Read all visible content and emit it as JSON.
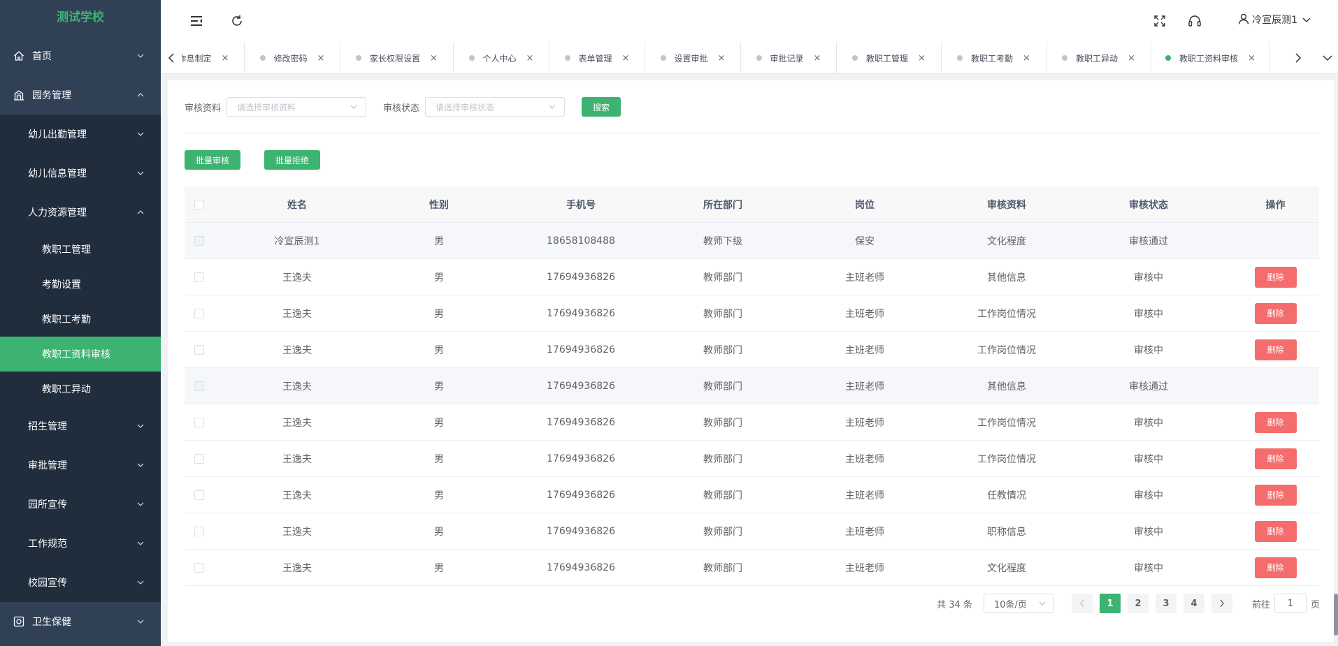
{
  "app": {
    "title": "测试学校",
    "accent": "#3cb371",
    "sidebar_bg": "#304156"
  },
  "sidebar": {
    "items": [
      {
        "label": "首页",
        "icon": "home-icon",
        "level": 1,
        "expanded": false
      },
      {
        "label": "园务管理",
        "icon": "building-icon",
        "level": 1,
        "expanded": true
      },
      {
        "label": "幼儿出勤管理",
        "level": 2,
        "expanded": false
      },
      {
        "label": "幼儿信息管理",
        "level": 2,
        "expanded": false
      },
      {
        "label": "人力资源管理",
        "level": 2,
        "expanded": true
      },
      {
        "label": "教职工管理",
        "level": 3
      },
      {
        "label": "考勤设置",
        "level": 3
      },
      {
        "label": "教职工考勤",
        "level": 3
      },
      {
        "label": "教职工资料审核",
        "level": 3,
        "active": true
      },
      {
        "label": "教职工异动",
        "level": 3
      },
      {
        "label": "招生管理",
        "level": 2,
        "expanded": false
      },
      {
        "label": "审批管理",
        "level": 2,
        "expanded": false
      },
      {
        "label": "园所宣传",
        "level": 2,
        "expanded": false
      },
      {
        "label": "工作规范",
        "level": 2,
        "expanded": false
      },
      {
        "label": "校园宣传",
        "level": 2,
        "expanded": false
      },
      {
        "label": "卫生保健",
        "icon": "health-icon",
        "level": 1,
        "expanded": false
      }
    ]
  },
  "header": {
    "user_name": "冷宣辰测1",
    "icons": [
      "menu-fold-icon",
      "refresh-icon",
      "fullscreen-icon",
      "headset-icon",
      "user-icon"
    ]
  },
  "tags": {
    "items": [
      {
        "label": "作息制定",
        "active": false,
        "dot": false
      },
      {
        "label": "修改密码",
        "active": false,
        "dot": true
      },
      {
        "label": "家长权限设置",
        "active": false,
        "dot": true
      },
      {
        "label": "个人中心",
        "active": false,
        "dot": true
      },
      {
        "label": "表单管理",
        "active": false,
        "dot": true
      },
      {
        "label": "设置审批",
        "active": false,
        "dot": true
      },
      {
        "label": "审批记录",
        "active": false,
        "dot": true
      },
      {
        "label": "教职工管理",
        "active": false,
        "dot": true
      },
      {
        "label": "教职工考勤",
        "active": false,
        "dot": true
      },
      {
        "label": "教职工异动",
        "active": false,
        "dot": true
      },
      {
        "label": "教职工资料审核",
        "active": true,
        "dot": true
      }
    ],
    "close_glyph": "×"
  },
  "filter": {
    "data_label": "审核资料",
    "data_placeholder": "请选择审核资料",
    "status_label": "审核状态",
    "status_placeholder": "请选择审核状态",
    "search_label": "搜索"
  },
  "actions": {
    "batch_approve": "批量审核",
    "batch_reject": "批量拒绝"
  },
  "table": {
    "columns": [
      "姓名",
      "性别",
      "手机号",
      "所在部门",
      "岗位",
      "审核资料",
      "审核状态",
      "操作"
    ],
    "delete_label": "删除",
    "rows": [
      {
        "name": "冷宣辰测1",
        "gender": "男",
        "phone": "18658108488",
        "dept": "教师下级",
        "post": "保安",
        "data": "文化程度",
        "status": "审核通过",
        "deletable": false
      },
      {
        "name": "王逸夫",
        "gender": "男",
        "phone": "17694936826",
        "dept": "教师部门",
        "post": "主班老师",
        "data": "其他信息",
        "status": "审核中",
        "deletable": true
      },
      {
        "name": "王逸夫",
        "gender": "男",
        "phone": "17694936826",
        "dept": "教师部门",
        "post": "主班老师",
        "data": "工作岗位情况",
        "status": "审核中",
        "deletable": true
      },
      {
        "name": "王逸夫",
        "gender": "男",
        "phone": "17694936826",
        "dept": "教师部门",
        "post": "主班老师",
        "data": "工作岗位情况",
        "status": "审核中",
        "deletable": true
      },
      {
        "name": "王逸夫",
        "gender": "男",
        "phone": "17694936826",
        "dept": "教师部门",
        "post": "主班老师",
        "data": "其他信息",
        "status": "审核通过",
        "deletable": false
      },
      {
        "name": "王逸夫",
        "gender": "男",
        "phone": "17694936826",
        "dept": "教师部门",
        "post": "主班老师",
        "data": "工作岗位情况",
        "status": "审核中",
        "deletable": true
      },
      {
        "name": "王逸夫",
        "gender": "男",
        "phone": "17694936826",
        "dept": "教师部门",
        "post": "主班老师",
        "data": "工作岗位情况",
        "status": "审核中",
        "deletable": true
      },
      {
        "name": "王逸夫",
        "gender": "男",
        "phone": "17694936826",
        "dept": "教师部门",
        "post": "主班老师",
        "data": "任教情况",
        "status": "审核中",
        "deletable": true
      },
      {
        "name": "王逸夫",
        "gender": "男",
        "phone": "17694936826",
        "dept": "教师部门",
        "post": "主班老师",
        "data": "职称信息",
        "status": "审核中",
        "deletable": true
      },
      {
        "name": "王逸夫",
        "gender": "男",
        "phone": "17694936826",
        "dept": "教师部门",
        "post": "主班老师",
        "data": "文化程度",
        "status": "审核中",
        "deletable": true
      }
    ]
  },
  "pagination": {
    "total": "共 34 条",
    "page_size": "10条/页",
    "pages": [
      "1",
      "2",
      "3",
      "4"
    ],
    "current": "1",
    "goto_label": "前往",
    "goto_value": "1",
    "page_unit": "页"
  }
}
